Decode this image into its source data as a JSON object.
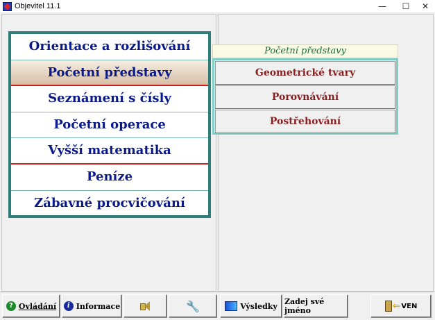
{
  "window": {
    "title": "Objevitel 11.1",
    "minimize": "—",
    "maximize": "☐",
    "close": "✕"
  },
  "main_menu": {
    "items": [
      {
        "label": "Orientace a rozlišování",
        "selected": false
      },
      {
        "label": "Početní představy",
        "selected": true
      },
      {
        "label": "Seznámení s čísly",
        "selected": false
      },
      {
        "label": "Početní operace",
        "selected": false
      },
      {
        "label": "Vyšší matematika",
        "selected": false
      },
      {
        "label": "Peníze",
        "selected": false
      },
      {
        "label": "Zábavné procvičování",
        "selected": false
      }
    ]
  },
  "submenu": {
    "header": "Početní představy",
    "items": [
      {
        "label": "Geometrické tvary"
      },
      {
        "label": "Porovnávání"
      },
      {
        "label": "Postřehování"
      }
    ]
  },
  "toolbar": {
    "help_label": "Ovládání",
    "info_label": "Informace",
    "results_label": "Výsledky",
    "name_label": "Zadej své jméno",
    "exit_label": "VEN",
    "icons": {
      "help": "question-icon",
      "info": "info-icon",
      "sound": "speaker-icon",
      "settings": "wrench-icon",
      "results": "chart-icon",
      "exit": "door-exit-icon"
    }
  },
  "colors": {
    "menu_border": "#2e7d78",
    "menu_text": "#0a1a8a",
    "submenu_text": "#8a1f1f",
    "submenu_header_text": "#1e6b32",
    "separator_red": "#c81e1e"
  }
}
